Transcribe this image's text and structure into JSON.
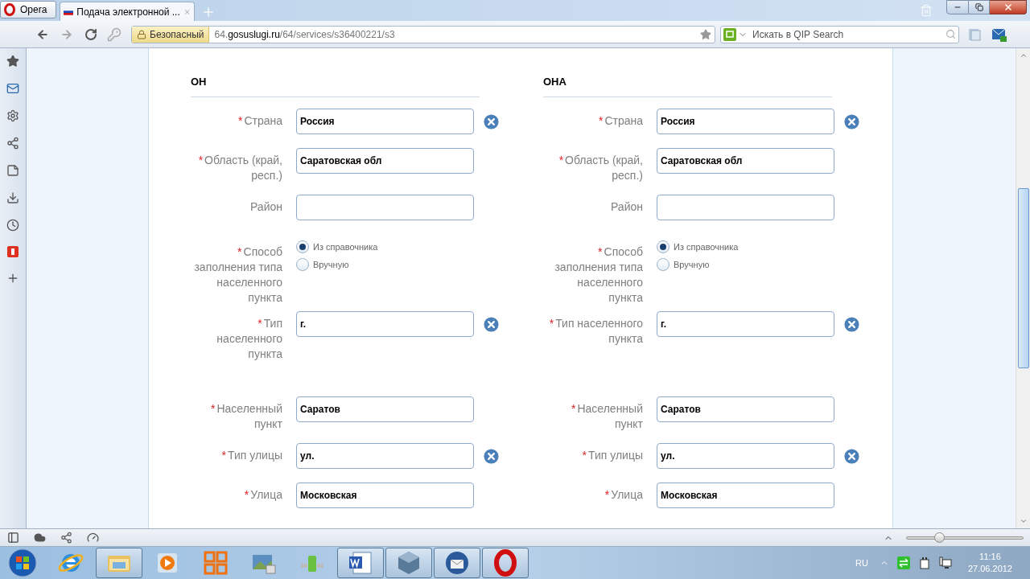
{
  "browser": {
    "menu_button": "Opera",
    "tabs": [
      {
        "title": "Подача электронной ...",
        "selected": true
      }
    ],
    "security_badge": "Безопасный",
    "url": {
      "prefix": "64.",
      "domain": "gosuslugi.ru",
      "path": "/64/services/s36400221/s3"
    },
    "search_placeholder": "Искать в QIP Search"
  },
  "form": {
    "columns": [
      {
        "heading": "ОН",
        "fields": [
          {
            "label": "Страна",
            "required_mark": "*",
            "kind": "text",
            "value": "Россия",
            "clearable": true
          },
          {
            "label": "Область (край, респ.)",
            "required_mark": "*",
            "kind": "text",
            "value": "Саратовская обл",
            "clearable": false
          },
          {
            "label": "Район",
            "kind": "text",
            "clearable": false
          },
          {
            "label": "Способ заполнения типа населенного пункта",
            "required_mark": "*",
            "kind": "radio",
            "options": [
              {
                "label": "Из справочника",
                "selected": true
              },
              {
                "label": "Вручную",
                "selected": false
              }
            ]
          },
          {
            "label": "Тип населенного пункта",
            "required_mark": "*",
            "kind": "text",
            "value": "г.",
            "clearable": true
          },
          {
            "label": "Населенный пункт",
            "required_mark": "*",
            "kind": "text",
            "value": "Саратов",
            "clearable": false
          },
          {
            "label": "Тип улицы",
            "required_mark": "*",
            "kind": "text",
            "value": "ул.",
            "clearable": true
          },
          {
            "label": "Улица",
            "required_mark": "*",
            "kind": "text",
            "value": "Московская",
            "clearable": false
          }
        ]
      },
      {
        "heading": "ОНА",
        "fields": [
          {
            "label": "Страна",
            "required_mark": "*",
            "kind": "text",
            "value": "Россия",
            "clearable": true
          },
          {
            "label": "Область (край, респ.)",
            "required_mark": "*",
            "kind": "text",
            "value": "Саратовская обл",
            "clearable": false
          },
          {
            "label": "Район",
            "kind": "text",
            "clearable": false
          },
          {
            "label": "Способ заполнения типа населенного пункта",
            "required_mark": "*",
            "kind": "radio",
            "options": [
              {
                "label": "Из справочника",
                "selected": true
              },
              {
                "label": "Вручную",
                "selected": false
              }
            ]
          },
          {
            "label": "Тип населенного пункта",
            "required_mark": "*",
            "kind": "text",
            "value": "г.",
            "clearable": true
          },
          {
            "label": "Населенный пункт",
            "required_mark": "*",
            "kind": "text",
            "value": "Саратов",
            "clearable": false
          },
          {
            "label": "Тип улицы",
            "required_mark": "*",
            "kind": "text",
            "value": "ул.",
            "clearable": true
          },
          {
            "label": "Улица",
            "required_mark": "*",
            "kind": "text",
            "value": "Московская",
            "clearable": false
          }
        ]
      }
    ]
  },
  "status_bar": {
    "zoom_slider": {
      "level": 0.28
    }
  },
  "taskbar": {
    "apps": [
      {
        "running": false
      },
      {
        "running": true
      },
      {
        "running": false
      },
      {
        "running": false
      },
      {
        "running": false
      },
      {
        "running": false
      },
      {
        "running": true
      },
      {
        "running": true
      },
      {
        "running": true
      },
      {
        "running": true
      }
    ],
    "language": "RU",
    "time": "11:16",
    "date": "27.06.2012"
  }
}
